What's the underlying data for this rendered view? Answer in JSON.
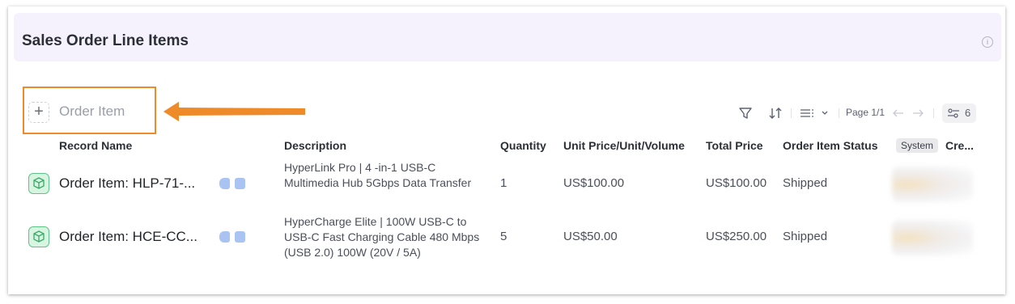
{
  "section": {
    "title": "Sales Order Line Items",
    "info_icon": "info-icon"
  },
  "add_button": {
    "label": "Order Item",
    "icon": "plus-icon"
  },
  "toolbar": {
    "page_label": "Page 1/1",
    "column_count": "6",
    "icons": [
      "filter-icon",
      "sort-icon",
      "view-options-icon",
      "prev-page-icon",
      "next-page-icon",
      "columns-icon"
    ]
  },
  "table": {
    "headers": {
      "record_name": "Record Name",
      "description": "Description",
      "quantity": "Quantity",
      "unit_price": "Unit Price/Unit/Volume",
      "total_price": "Total Price",
      "status": "Order Item Status",
      "system_badge": "System",
      "created": "Cre..."
    },
    "rows": [
      {
        "record_name": "Order Item: HLP-71-...",
        "description": "HyperLink Pro | 4 -in-1 USB-C Multimedia Hub 5Gbps Data Transfer",
        "quantity": "1",
        "unit_price": "US$100.00",
        "total_price": "US$100.00",
        "status": "Shipped"
      },
      {
        "record_name": "Order Item: HCE-CC...",
        "description": "HyperCharge Elite | 100W USB-C to USB-C Fast Charging Cable 480 Mbps (USB 2.0) 100W (20V / 5A)",
        "quantity": "5",
        "unit_price": "US$50.00",
        "total_price": "US$250.00",
        "status": "Shipped"
      }
    ]
  },
  "colors": {
    "header_bg": "#f6f2fd",
    "highlight": "#ef8a2a",
    "row_icon": "#5fc487",
    "pill": "#a9c4f2"
  }
}
